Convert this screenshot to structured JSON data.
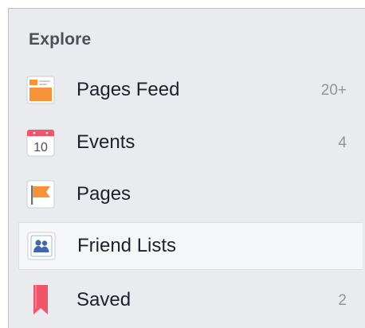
{
  "explore": {
    "title": "Explore",
    "items": [
      {
        "id": "pages-feed",
        "label": "Pages Feed",
        "count": "20+",
        "icon": "pages-feed-icon",
        "active": false
      },
      {
        "id": "events",
        "label": "Events",
        "count": "4",
        "icon": "calendar-icon",
        "calendar_day": "10",
        "active": false
      },
      {
        "id": "pages",
        "label": "Pages",
        "count": "",
        "icon": "flag-icon",
        "active": false
      },
      {
        "id": "friend-lists",
        "label": "Friend Lists",
        "count": "",
        "icon": "friends-icon",
        "active": true
      },
      {
        "id": "saved",
        "label": "Saved",
        "count": "2",
        "icon": "bookmark-icon",
        "active": false
      }
    ]
  },
  "colors": {
    "panel_bg": "#e9ebee",
    "active_bg": "#f5f6f7",
    "orange": "#f7923b",
    "red": "#f0556a",
    "blue": "#4267b2",
    "count_gray": "#90949c"
  }
}
